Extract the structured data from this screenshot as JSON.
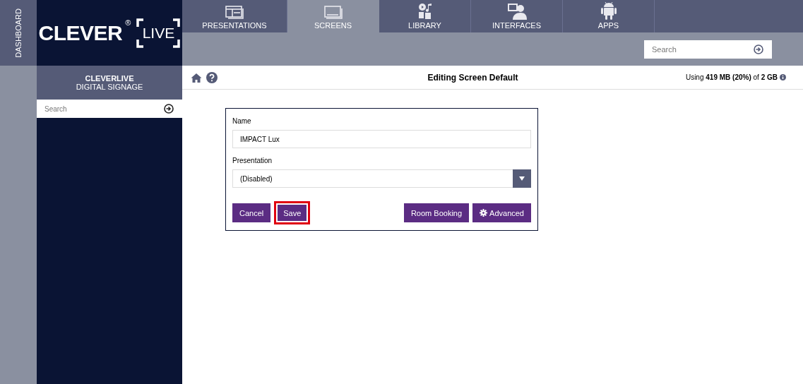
{
  "side_strip": {
    "label": "DASHBOARD"
  },
  "logo": {
    "word": "CLEVER",
    "mark": "®",
    "boxed": "LIVE"
  },
  "sidebar": {
    "title": "CLEVERLIVE",
    "subtitle": "DIGITAL SIGNAGE",
    "search": {
      "placeholder": "Search"
    }
  },
  "tabs": [
    {
      "label": "PRESENTATIONS",
      "selected": false
    },
    {
      "label": "SCREENS",
      "selected": true
    },
    {
      "label": "LIBRARY",
      "selected": false
    },
    {
      "label": "INTERFACES",
      "selected": false
    },
    {
      "label": "APPS",
      "selected": false
    }
  ],
  "top_search": {
    "placeholder": "Search"
  },
  "header": {
    "title": "Editing Screen Default",
    "usage": "Using **419 MB (20%)** of **2 GB**"
  },
  "form": {
    "fields": [
      {
        "kind": "text",
        "label": "Name",
        "value": "IMPACT Lux"
      },
      {
        "kind": "select",
        "label": "Presentation",
        "value": "(Disabled)"
      }
    ],
    "buttons": [
      {
        "label": "Cancel",
        "highlighted": false
      },
      {
        "label": "Save",
        "highlighted": true
      },
      {
        "label": "Room Booking",
        "highlighted": false
      },
      {
        "label": "Advanced",
        "highlighted": false
      }
    ]
  }
}
